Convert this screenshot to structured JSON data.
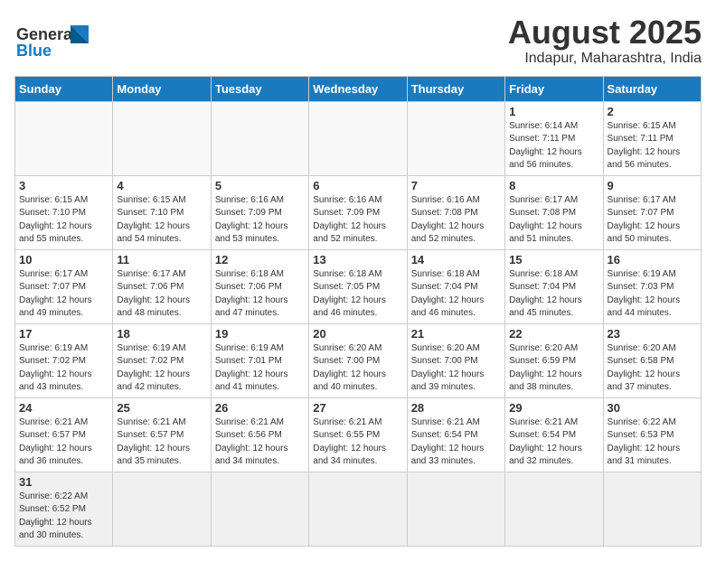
{
  "header": {
    "title": "August 2025",
    "subtitle": "Indapur, Maharashtra, India"
  },
  "logo": {
    "line1": "General",
    "line2": "Blue"
  },
  "days": [
    "Sunday",
    "Monday",
    "Tuesday",
    "Wednesday",
    "Thursday",
    "Friday",
    "Saturday"
  ],
  "weeks": [
    [
      {
        "day": "",
        "info": ""
      },
      {
        "day": "",
        "info": ""
      },
      {
        "day": "",
        "info": ""
      },
      {
        "day": "",
        "info": ""
      },
      {
        "day": "",
        "info": ""
      },
      {
        "day": "1",
        "info": "Sunrise: 6:14 AM\nSunset: 7:11 PM\nDaylight: 12 hours and 56 minutes."
      },
      {
        "day": "2",
        "info": "Sunrise: 6:15 AM\nSunset: 7:11 PM\nDaylight: 12 hours and 56 minutes."
      }
    ],
    [
      {
        "day": "3",
        "info": "Sunrise: 6:15 AM\nSunset: 7:10 PM\nDaylight: 12 hours and 55 minutes."
      },
      {
        "day": "4",
        "info": "Sunrise: 6:15 AM\nSunset: 7:10 PM\nDaylight: 12 hours and 54 minutes."
      },
      {
        "day": "5",
        "info": "Sunrise: 6:16 AM\nSunset: 7:09 PM\nDaylight: 12 hours and 53 minutes."
      },
      {
        "day": "6",
        "info": "Sunrise: 6:16 AM\nSunset: 7:09 PM\nDaylight: 12 hours and 52 minutes."
      },
      {
        "day": "7",
        "info": "Sunrise: 6:16 AM\nSunset: 7:08 PM\nDaylight: 12 hours and 52 minutes."
      },
      {
        "day": "8",
        "info": "Sunrise: 6:17 AM\nSunset: 7:08 PM\nDaylight: 12 hours and 51 minutes."
      },
      {
        "day": "9",
        "info": "Sunrise: 6:17 AM\nSunset: 7:07 PM\nDaylight: 12 hours and 50 minutes."
      }
    ],
    [
      {
        "day": "10",
        "info": "Sunrise: 6:17 AM\nSunset: 7:07 PM\nDaylight: 12 hours and 49 minutes."
      },
      {
        "day": "11",
        "info": "Sunrise: 6:17 AM\nSunset: 7:06 PM\nDaylight: 12 hours and 48 minutes."
      },
      {
        "day": "12",
        "info": "Sunrise: 6:18 AM\nSunset: 7:06 PM\nDaylight: 12 hours and 47 minutes."
      },
      {
        "day": "13",
        "info": "Sunrise: 6:18 AM\nSunset: 7:05 PM\nDaylight: 12 hours and 46 minutes."
      },
      {
        "day": "14",
        "info": "Sunrise: 6:18 AM\nSunset: 7:04 PM\nDaylight: 12 hours and 46 minutes."
      },
      {
        "day": "15",
        "info": "Sunrise: 6:18 AM\nSunset: 7:04 PM\nDaylight: 12 hours and 45 minutes."
      },
      {
        "day": "16",
        "info": "Sunrise: 6:19 AM\nSunset: 7:03 PM\nDaylight: 12 hours and 44 minutes."
      }
    ],
    [
      {
        "day": "17",
        "info": "Sunrise: 6:19 AM\nSunset: 7:02 PM\nDaylight: 12 hours and 43 minutes."
      },
      {
        "day": "18",
        "info": "Sunrise: 6:19 AM\nSunset: 7:02 PM\nDaylight: 12 hours and 42 minutes."
      },
      {
        "day": "19",
        "info": "Sunrise: 6:19 AM\nSunset: 7:01 PM\nDaylight: 12 hours and 41 minutes."
      },
      {
        "day": "20",
        "info": "Sunrise: 6:20 AM\nSunset: 7:00 PM\nDaylight: 12 hours and 40 minutes."
      },
      {
        "day": "21",
        "info": "Sunrise: 6:20 AM\nSunset: 7:00 PM\nDaylight: 12 hours and 39 minutes."
      },
      {
        "day": "22",
        "info": "Sunrise: 6:20 AM\nSunset: 6:59 PM\nDaylight: 12 hours and 38 minutes."
      },
      {
        "day": "23",
        "info": "Sunrise: 6:20 AM\nSunset: 6:58 PM\nDaylight: 12 hours and 37 minutes."
      }
    ],
    [
      {
        "day": "24",
        "info": "Sunrise: 6:21 AM\nSunset: 6:57 PM\nDaylight: 12 hours and 36 minutes."
      },
      {
        "day": "25",
        "info": "Sunrise: 6:21 AM\nSunset: 6:57 PM\nDaylight: 12 hours and 35 minutes."
      },
      {
        "day": "26",
        "info": "Sunrise: 6:21 AM\nSunset: 6:56 PM\nDaylight: 12 hours and 34 minutes."
      },
      {
        "day": "27",
        "info": "Sunrise: 6:21 AM\nSunset: 6:55 PM\nDaylight: 12 hours and 34 minutes."
      },
      {
        "day": "28",
        "info": "Sunrise: 6:21 AM\nSunset: 6:54 PM\nDaylight: 12 hours and 33 minutes."
      },
      {
        "day": "29",
        "info": "Sunrise: 6:21 AM\nSunset: 6:54 PM\nDaylight: 12 hours and 32 minutes."
      },
      {
        "day": "30",
        "info": "Sunrise: 6:22 AM\nSunset: 6:53 PM\nDaylight: 12 hours and 31 minutes."
      }
    ],
    [
      {
        "day": "31",
        "info": "Sunrise: 6:22 AM\nSunset: 6:52 PM\nDaylight: 12 hours and 30 minutes."
      },
      {
        "day": "",
        "info": ""
      },
      {
        "day": "",
        "info": ""
      },
      {
        "day": "",
        "info": ""
      },
      {
        "day": "",
        "info": ""
      },
      {
        "day": "",
        "info": ""
      },
      {
        "day": "",
        "info": ""
      }
    ]
  ]
}
